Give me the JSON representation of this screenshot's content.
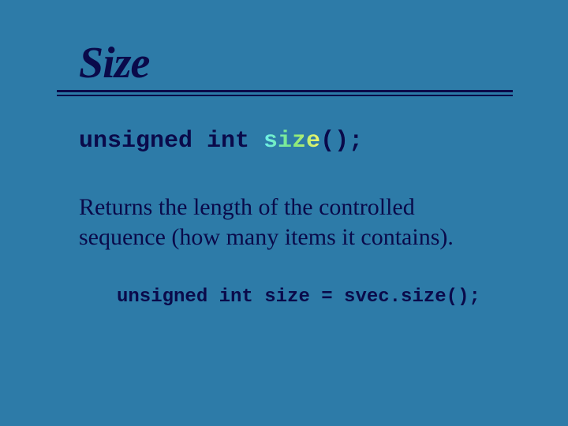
{
  "title": "Size",
  "signature": {
    "prefix": "unsigned int ",
    "func": "size",
    "suffix": "();"
  },
  "description": "Returns the length of the controlled sequence (how many items it contains).",
  "example": "unsigned int size = svec.size();"
}
